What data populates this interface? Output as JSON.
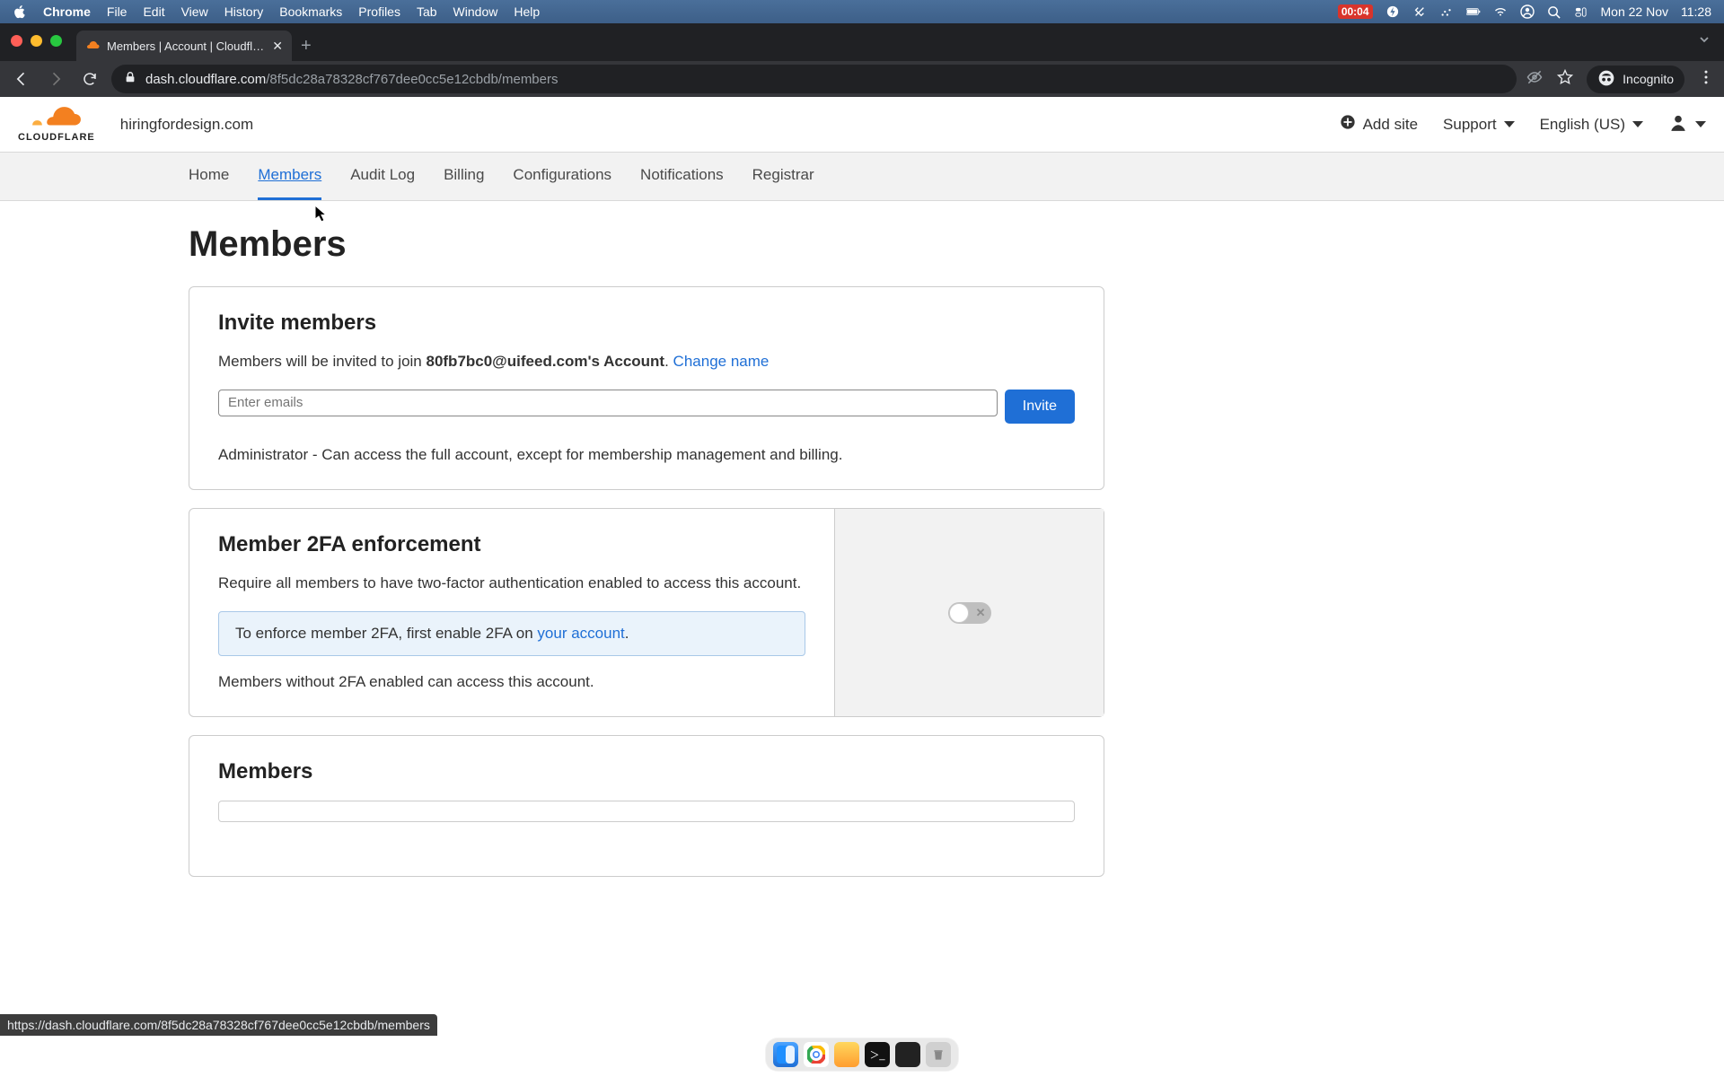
{
  "macos": {
    "app": "Chrome",
    "menus": [
      "File",
      "Edit",
      "View",
      "History",
      "Bookmarks",
      "Profiles",
      "Tab",
      "Window",
      "Help"
    ],
    "battery_time": "00:04",
    "date": "Mon 22 Nov",
    "time": "11:28"
  },
  "browser": {
    "tab_title": "Members | Account | Cloudflare",
    "url_domain": "dash.cloudflare.com",
    "url_path": "/8f5dc28a78328cf767dee0cc5e12cbdb/members",
    "incognito_label": "Incognito"
  },
  "cf_header": {
    "logo_text": "CLOUDFLARE",
    "account": "hiringfordesign.com",
    "add_site": "Add site",
    "support": "Support",
    "language": "English (US)"
  },
  "subnav": {
    "items": [
      "Home",
      "Members",
      "Audit Log",
      "Billing",
      "Configurations",
      "Notifications",
      "Registrar"
    ],
    "active_index": 1
  },
  "page": {
    "title": "Members",
    "invite": {
      "heading": "Invite members",
      "intro_prefix": "Members will be invited to join ",
      "account_name": "80fb7bc0@uifeed.com's Account",
      "intro_suffix": ". ",
      "change_link": "Change name",
      "placeholder": "Enter emails",
      "button": "Invite",
      "role_desc": "Administrator - Can access the full account, except for membership management and billing."
    },
    "twofa": {
      "heading": "Member 2FA enforcement",
      "desc": "Require all members to have two-factor authentication enabled to access this account.",
      "info_prefix": "To enforce member 2FA, first enable 2FA on ",
      "info_link": "your account",
      "info_suffix": ".",
      "footnote": "Members without 2FA enabled can access this account."
    },
    "members_section": {
      "heading": "Members"
    }
  },
  "status_url": "https://dash.cloudflare.com/8f5dc28a78328cf767dee0cc5e12cbdb/members"
}
